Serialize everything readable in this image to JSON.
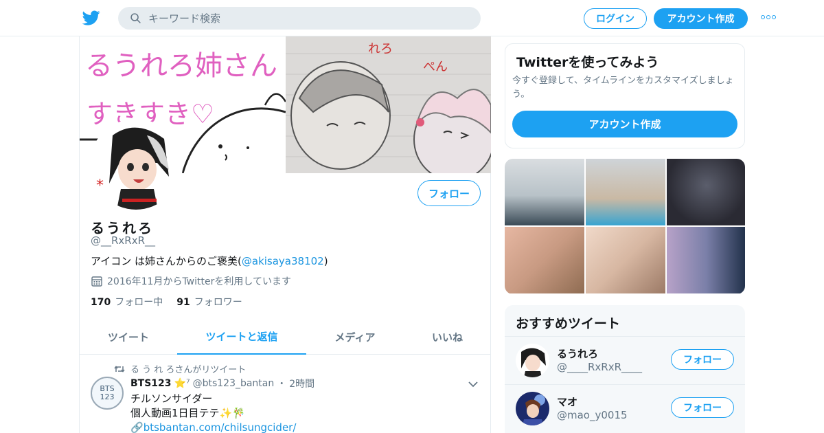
{
  "header": {
    "logo_icon": "twitter-bird-icon",
    "search_placeholder": "キーワード検索",
    "login_label": "ログイン",
    "signup_label": "アカウント作成",
    "more_icon": "more-dots-icon",
    "accent_color": "#1da1f2"
  },
  "profile": {
    "banner": {
      "left_line1": "るうれろ姉さん",
      "left_line2": "すきすき♡",
      "right_text1": "れろ",
      "right_text2": "ぺん"
    },
    "follow_label": "フォロー",
    "name": "るうれろ",
    "handle": "@__RxRxR__",
    "bio_text": "アイコン は姉さんからのご褒美(",
    "bio_link": "@akisaya38102",
    "bio_close": ")",
    "joined": "2016年11月からTwitterを利用しています",
    "following_count": "170",
    "following_label": "フォロー中",
    "followers_count": "91",
    "followers_label": "フォロワー"
  },
  "tabs": [
    {
      "label": "ツイート",
      "active": false
    },
    {
      "label": "ツイートと返信",
      "active": true
    },
    {
      "label": "メディア",
      "active": false
    },
    {
      "label": "いいね",
      "active": false
    }
  ],
  "tweet": {
    "retweet_line": "る う れ ろさんがリツイート",
    "avatar_text_top": "BTS",
    "avatar_text_bottom": "123",
    "author_name": "BTS123",
    "author_badges": "⭐⁷",
    "author_handle": "@bts123_bantan",
    "separator": "・",
    "time": "2時間",
    "line1": "チルソンサイダー",
    "line2": "個人動画1日目テテ✨🎋",
    "link": "btsbantan.com/chilsungcider/"
  },
  "signup_card": {
    "title": "Twitterを使ってみよう",
    "description": "今すぐ登録して、タイムラインをカスタマイズしましょう。",
    "cta": "アカウント作成"
  },
  "media_grid": {
    "colors": [
      "#b8c2c8",
      "#c9b9a4",
      "#2a2a33",
      "#c89a82",
      "#d7b7a2",
      "#7a7fa8"
    ]
  },
  "suggestions": {
    "title": "おすすめツイート",
    "follow_label": "フォロー",
    "items": [
      {
        "name": "るうれろ",
        "handle": "@____RxRxR____"
      },
      {
        "name": "マオ",
        "handle": "@mao_y0015"
      }
    ]
  }
}
